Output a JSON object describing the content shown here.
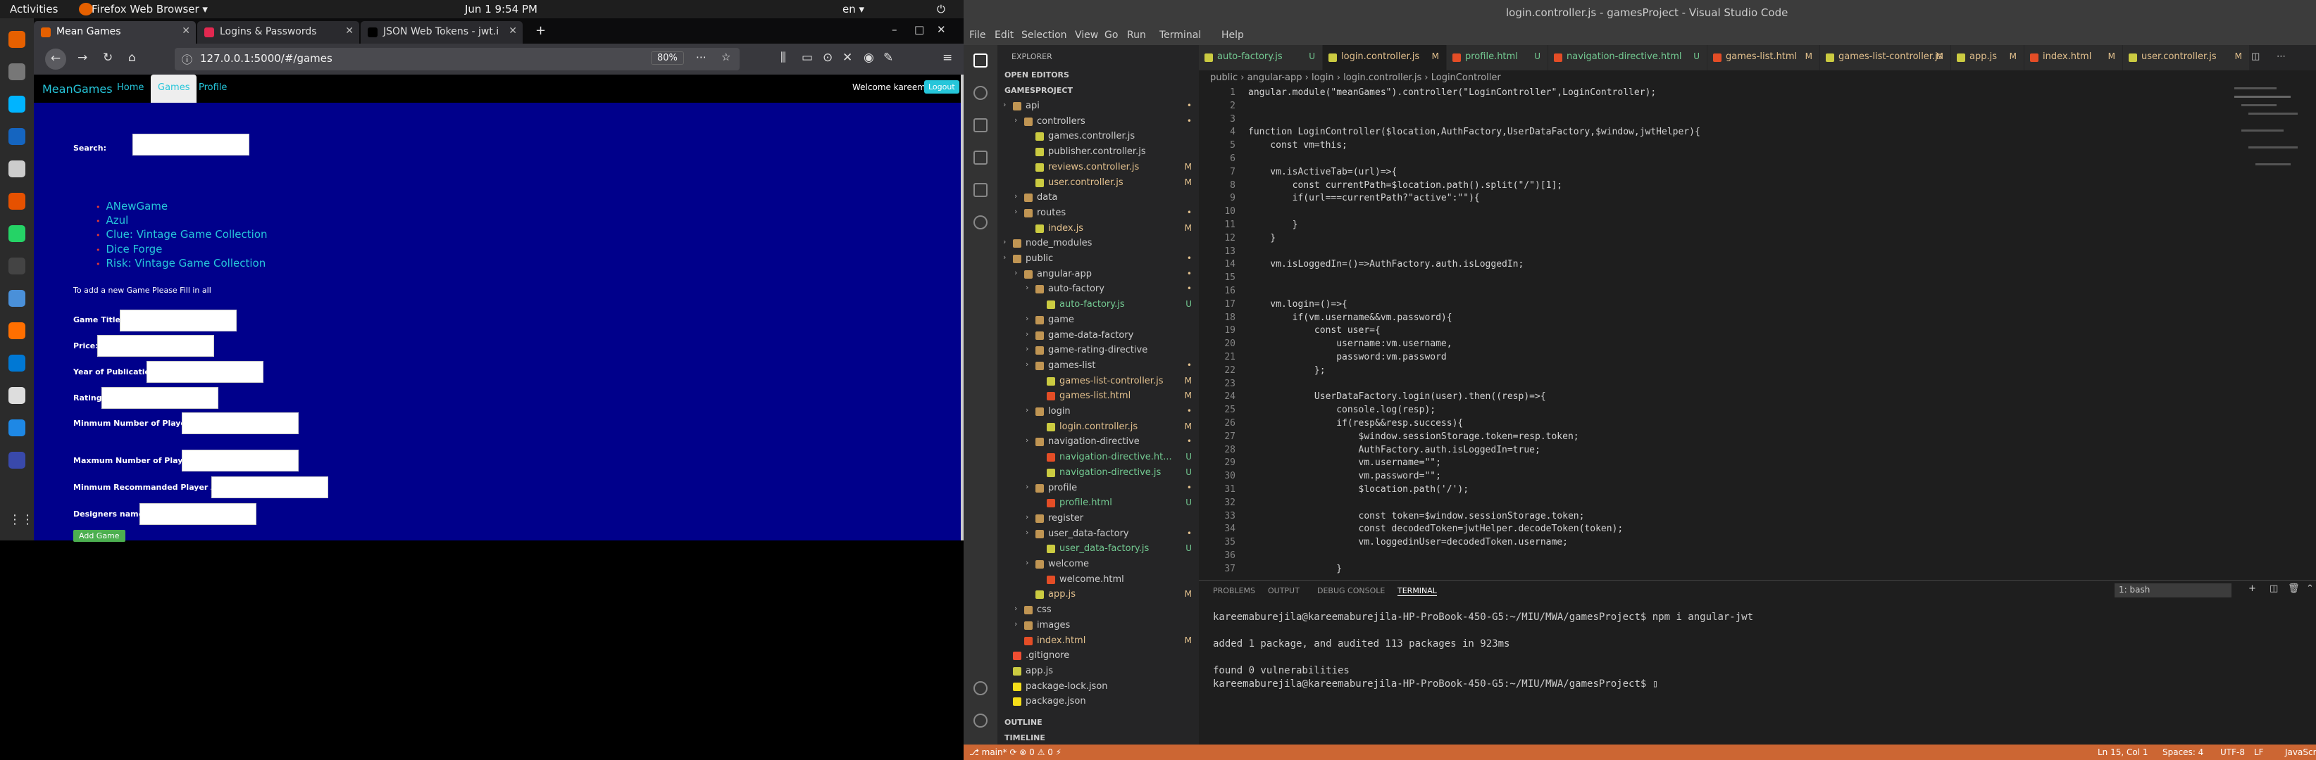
{
  "topbar": {
    "activities": "Activities",
    "app": "Firefox Web Browser ▾",
    "clock": "Jun 1  9:54 PM",
    "lang": "en ▾"
  },
  "firefox": {
    "tabs": [
      {
        "label": "Mean Games",
        "color": "#e66000"
      },
      {
        "label": "Logins & Passwords",
        "color": "#e22850"
      },
      {
        "label": "JSON Web Tokens - jwt.i",
        "color": "#000000"
      }
    ],
    "url": "127.0.0.1:5000/#/games",
    "zoom": "80%"
  },
  "app": {
    "brand": "MeanGames",
    "nav": [
      "Home",
      "Games",
      "Profile"
    ],
    "welcome": "Welcome kareem",
    "logout": "Logout",
    "search_label": "Search:",
    "games": [
      "ANewGame",
      "Azul",
      "Clue: Vintage Game Collection",
      "Dice Forge",
      "Risk: Vintage Game Collection"
    ],
    "add_hint": "To add a new Game Please Fill in all",
    "fields": [
      "Game Title:",
      "Price:",
      "Year of Publication:",
      "Rating:",
      "Minmum Number of Players:",
      "Maxmum Number of Players:",
      "Minmum Recommanded Player Age:",
      "Designers name:"
    ],
    "add_button": "Add Game"
  },
  "vscode": {
    "title": "login.controller.js - gamesProject - Visual Studio Code",
    "menu": [
      "File",
      "Edit",
      "Selection",
      "View",
      "Go",
      "Run",
      "Terminal",
      "Help"
    ],
    "explorer": "EXPLORER",
    "open_editors": "OPEN EDITORS",
    "project": "GAMESPROJECT",
    "tree": [
      {
        "n": "api",
        "t": "fold",
        "d": 1,
        "b": "•"
      },
      {
        "n": "controllers",
        "t": "fold",
        "d": 2,
        "b": "•"
      },
      {
        "n": "games.controller.js",
        "t": "fjs",
        "d": 3,
        "b": ""
      },
      {
        "n": "publisher.controller.js",
        "t": "fjs",
        "d": 3,
        "b": ""
      },
      {
        "n": "reviews.controller.js",
        "t": "fjs",
        "d": 3,
        "b": "M"
      },
      {
        "n": "user.controller.js",
        "t": "fjs",
        "d": 3,
        "b": "M"
      },
      {
        "n": "data",
        "t": "fold",
        "d": 2,
        "b": ""
      },
      {
        "n": "routes",
        "t": "fold",
        "d": 2,
        "b": "•"
      },
      {
        "n": "index.js",
        "t": "fjs",
        "d": 3,
        "b": "M"
      },
      {
        "n": "node_modules",
        "t": "fold",
        "d": 1,
        "b": ""
      },
      {
        "n": "public",
        "t": "fold",
        "d": 1,
        "b": "•"
      },
      {
        "n": "angular-app",
        "t": "fold",
        "d": 2,
        "b": "•"
      },
      {
        "n": "auto-factory",
        "t": "fold",
        "d": 3,
        "b": "•"
      },
      {
        "n": "auto-factory.js",
        "t": "fjs",
        "d": 4,
        "b": "U"
      },
      {
        "n": "game",
        "t": "fold",
        "d": 3,
        "b": ""
      },
      {
        "n": "game-data-factory",
        "t": "fold",
        "d": 3,
        "b": ""
      },
      {
        "n": "game-rating-directive",
        "t": "fold",
        "d": 3,
        "b": ""
      },
      {
        "n": "games-list",
        "t": "fold",
        "d": 3,
        "b": "•"
      },
      {
        "n": "games-list-controller.js",
        "t": "fjs",
        "d": 4,
        "b": "M"
      },
      {
        "n": "games-list.html",
        "t": "fhtml",
        "d": 4,
        "b": "M"
      },
      {
        "n": "login",
        "t": "fold",
        "d": 3,
        "b": "•"
      },
      {
        "n": "login.controller.js",
        "t": "fjs",
        "d": 4,
        "b": "M"
      },
      {
        "n": "navigation-directive",
        "t": "fold",
        "d": 3,
        "b": "•"
      },
      {
        "n": "navigation-directive.ht...",
        "t": "fhtml",
        "d": 4,
        "b": "U"
      },
      {
        "n": "navigation-directive.js",
        "t": "fjs",
        "d": 4,
        "b": "U"
      },
      {
        "n": "profile",
        "t": "fold",
        "d": 3,
        "b": "•"
      },
      {
        "n": "profile.html",
        "t": "fhtml",
        "d": 4,
        "b": "U"
      },
      {
        "n": "register",
        "t": "fold",
        "d": 3,
        "b": ""
      },
      {
        "n": "user_data-factory",
        "t": "fold",
        "d": 3,
        "b": "•"
      },
      {
        "n": "user_data-factory.js",
        "t": "fjs",
        "d": 4,
        "b": "U"
      },
      {
        "n": "welcome",
        "t": "fold",
        "d": 3,
        "b": ""
      },
      {
        "n": "welcome.html",
        "t": "fhtml",
        "d": 4,
        "b": ""
      },
      {
        "n": "app.js",
        "t": "fjs",
        "d": 3,
        "b": "M"
      },
      {
        "n": "css",
        "t": "fold",
        "d": 2,
        "b": ""
      },
      {
        "n": "images",
        "t": "fold",
        "d": 2,
        "b": ""
      },
      {
        "n": "index.html",
        "t": "fhtml",
        "d": 2,
        "b": "M"
      },
      {
        "n": ".gitignore",
        "t": "fgit",
        "d": 1,
        "b": ""
      },
      {
        "n": "app.js",
        "t": "fjs",
        "d": 1,
        "b": ""
      },
      {
        "n": "package-lock.json",
        "t": "fjson",
        "d": 1,
        "b": ""
      },
      {
        "n": "package.json",
        "t": "fjson",
        "d": 1,
        "b": ""
      }
    ],
    "outline": "OUTLINE",
    "timeline": "TIMELINE",
    "tabs": [
      {
        "name": "auto-factory.js",
        "mark": "U",
        "t": "fjs"
      },
      {
        "name": "login.controller.js",
        "mark": "M",
        "t": "fjs"
      },
      {
        "name": "profile.html",
        "mark": "U",
        "t": "fhtml"
      },
      {
        "name": "navigation-directive.html",
        "mark": "U",
        "t": "fhtml"
      },
      {
        "name": "games-list.html",
        "mark": "M",
        "t": "fhtml"
      },
      {
        "name": "games-list-controller.js",
        "mark": "M",
        "t": "fjs"
      },
      {
        "name": "app.js",
        "mark": "M",
        "t": "fjs"
      },
      {
        "name": "index.html",
        "mark": "M",
        "t": "fhtml"
      },
      {
        "name": "user.controller.js",
        "mark": "M",
        "t": "fjs"
      }
    ],
    "breadcrumb": "public › angular-app › login › login.controller.js › LoginController",
    "code": [
      "angular.module(\"meanGames\").controller(\"LoginController\",LoginController);",
      "",
      "",
      "function LoginController($location,AuthFactory,UserDataFactory,$window,jwtHelper){",
      "    const vm=this;",
      "",
      "    vm.isActiveTab=(url)=>{",
      "        const currentPath=$location.path().split(\"/\")[1];",
      "        if(url===currentPath?\"active\":\"\"){",
      "",
      "        }",
      "    }",
      "",
      "    vm.isLoggedIn=()=>AuthFactory.auth.isLoggedIn;",
      "",
      "",
      "    vm.login=()=>{",
      "        if(vm.username&&vm.password){",
      "            const user={",
      "                username:vm.username,",
      "                password:vm.password",
      "            };",
      "",
      "            UserDataFactory.login(user).then((resp)=>{",
      "                console.log(resp);",
      "                if(resp&&resp.success){",
      "                    $window.sessionStorage.token=resp.token;",
      "                    AuthFactory.auth.isLoggedIn=true;",
      "                    vm.username=\"\";",
      "                    vm.password=\"\";",
      "                    $location.path('/');",
      "",
      "                    const token=$window.sessionStorage.token;",
      "                    const decodedToken=jwtHelper.decodeToken(token);",
      "                    vm.loggedinUser=decodedToken.username;",
      "",
      "                }"
    ],
    "panel_tabs": [
      "PROBLEMS",
      "OUTPUT",
      "DEBUG CONSOLE",
      "TERMINAL"
    ],
    "terminal_select": "1: bash",
    "terminal": [
      "kareemaburejila@kareemaburejila-HP-ProBook-450-G5:~/MIU/MWA/gamesProject$ npm i angular-jwt",
      "",
      "added 1 package, and audited 113 packages in 923ms",
      "",
      "found 0 vulnerabilities",
      "kareemaburejila@kareemaburejila-HP-ProBook-450-G5:~/MIU/MWA/gamesProject$ ▯"
    ],
    "status_left": "⎇ main*  ⟳  ⊗ 0 ⚠ 0  ⚡",
    "status_right": [
      "Ln 15, Col 1",
      "Spaces: 4",
      "UTF-8",
      "LF",
      "JavaScript"
    ]
  }
}
